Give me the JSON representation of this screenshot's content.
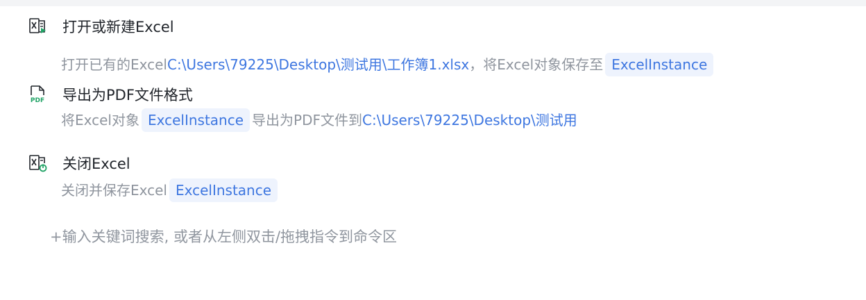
{
  "steps": [
    {
      "icon": "excel-open-icon",
      "title": "打开或新建Excel",
      "desc_prefix": "打开已有的Excel",
      "path": "C:\\Users\\79225\\Desktop\\测试用\\工作簿1.xlsx",
      "desc_mid": "，将Excel对象保存至",
      "variable": "ExcelInstance"
    },
    {
      "icon": "pdf-file-icon",
      "title": "导出为PDF文件格式",
      "desc_prefix": "将Excel对象",
      "variable": "ExcelInstance",
      "desc_mid": "导出为PDF文件到",
      "path": "C:\\Users\\79225\\Desktop\\测试用"
    },
    {
      "icon": "excel-close-icon",
      "title": "关闭Excel",
      "desc_prefix": "关闭并保存Excel",
      "variable": "ExcelInstance"
    }
  ],
  "add_hint": "+输入关键词搜索, 或者从左侧双击/拖拽指令到命令区",
  "colors": {
    "link": "#3d76e0",
    "chip_bg": "#eef3fd",
    "gray_text": "#8f959e",
    "title_text": "#1f2329",
    "excel_green": "#21a366"
  }
}
